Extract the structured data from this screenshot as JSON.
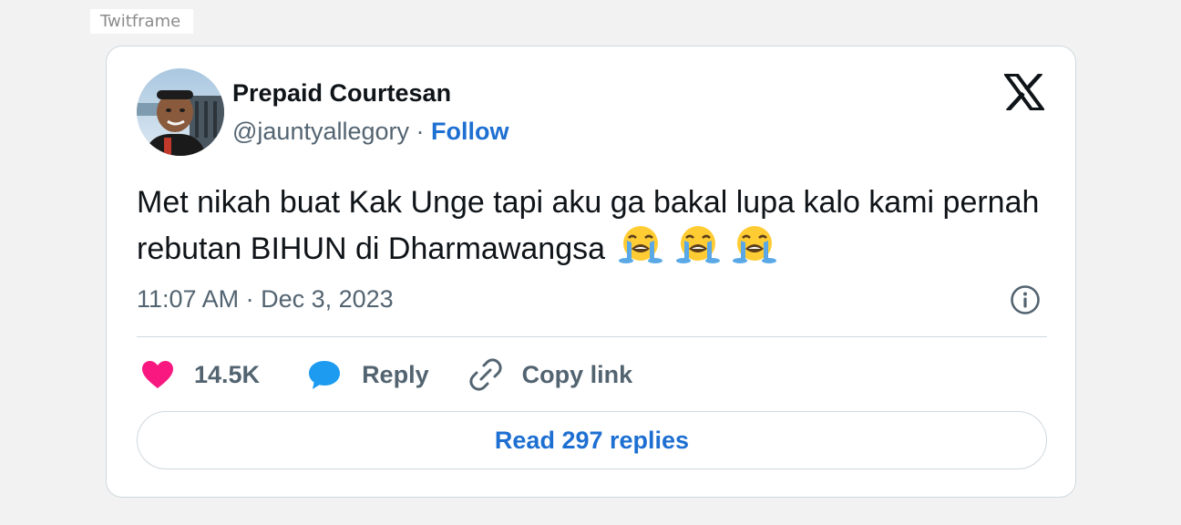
{
  "frame": {
    "label": "Twitframe"
  },
  "tweet": {
    "author_name": "Prepaid Courtesan",
    "handle": "@jauntyallegory",
    "separator": "·",
    "follow_label": "Follow",
    "text": "Met nikah buat Kak Unge tapi aku ga bakal lupa kalo kami pernah rebutan BIHUN di Dharmawangsa",
    "emojis": [
      "loudly-crying-face",
      "loudly-crying-face",
      "loudly-crying-face"
    ],
    "timestamp": "11:07 AM · Dec 3, 2023",
    "like_count": "14.5K",
    "reply_label": "Reply",
    "copy_link_label": "Copy link",
    "read_replies_label": "Read 297 replies"
  },
  "colors": {
    "link_blue": "#1d6fd1",
    "heart_pink": "#f91880",
    "reply_blue": "#1d9bf0",
    "text_dark": "#0f1419",
    "text_gray": "#536471",
    "border": "#cfd9de"
  },
  "icons": {
    "logo": "x-logo-icon",
    "info": "info-icon",
    "like": "heart-icon",
    "reply": "speech-bubble-icon",
    "copy": "link-icon"
  }
}
